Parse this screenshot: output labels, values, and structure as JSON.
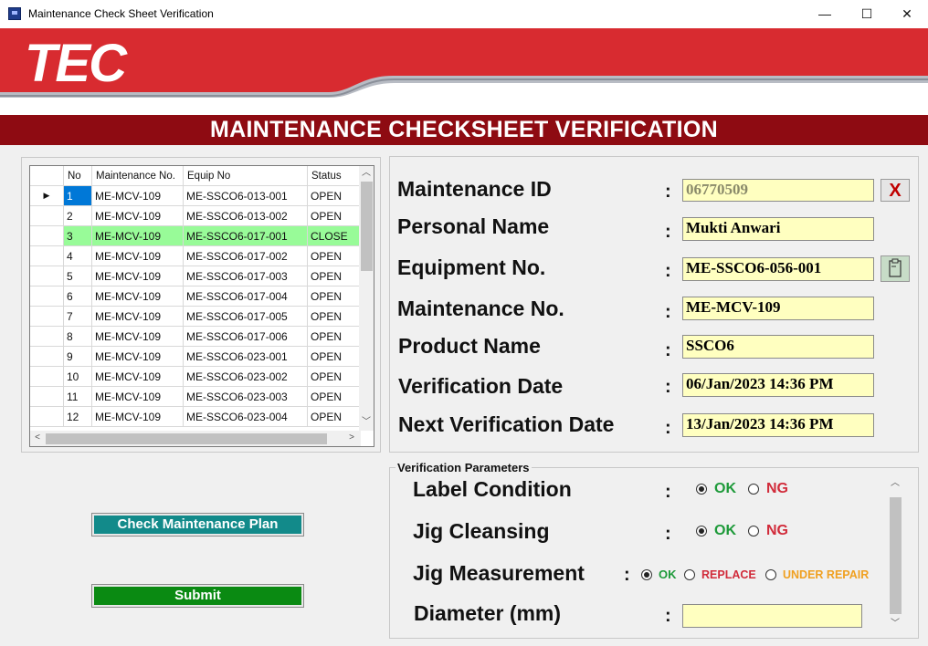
{
  "window": {
    "title": "Maintenance Check Sheet Verification",
    "minimize": "—",
    "maximize": "☐",
    "close": "✕"
  },
  "banner": {
    "logo": "TEC"
  },
  "header": {
    "title": "MAINTENANCE CHECKSHEET VERIFICATION"
  },
  "grid": {
    "columns": [
      "No",
      "Maintenance No.",
      "Equip No",
      "Status"
    ],
    "rows": [
      [
        "1",
        "ME-MCV-109",
        "ME-SSCO6-013-001",
        "OPEN"
      ],
      [
        "2",
        "ME-MCV-109",
        "ME-SSCO6-013-002",
        "OPEN"
      ],
      [
        "3",
        "ME-MCV-109",
        "ME-SSCO6-017-001",
        "CLOSE"
      ],
      [
        "4",
        "ME-MCV-109",
        "ME-SSCO6-017-002",
        "OPEN"
      ],
      [
        "5",
        "ME-MCV-109",
        "ME-SSCO6-017-003",
        "OPEN"
      ],
      [
        "6",
        "ME-MCV-109",
        "ME-SSCO6-017-004",
        "OPEN"
      ],
      [
        "7",
        "ME-MCV-109",
        "ME-SSCO6-017-005",
        "OPEN"
      ],
      [
        "8",
        "ME-MCV-109",
        "ME-SSCO6-017-006",
        "OPEN"
      ],
      [
        "9",
        "ME-MCV-109",
        "ME-SSCO6-023-001",
        "OPEN"
      ],
      [
        "10",
        "ME-MCV-109",
        "ME-SSCO6-023-002",
        "OPEN"
      ],
      [
        "11",
        "ME-MCV-109",
        "ME-SSCO6-023-003",
        "OPEN"
      ],
      [
        "12",
        "ME-MCV-109",
        "ME-SSCO6-023-004",
        "OPEN"
      ]
    ],
    "selected_row": 0,
    "close_row": 2
  },
  "buttons": {
    "check_plan": "Check Maintenance Plan",
    "submit": "Submit",
    "clear": "X"
  },
  "form": {
    "maintenance_id": {
      "label": "Maintenance ID",
      "value": "06770509"
    },
    "personal_name": {
      "label": "Personal Name",
      "value": "Mukti Anwari"
    },
    "equipment_no": {
      "label": "Equipment No.",
      "value": "ME-SSCO6-056-001"
    },
    "maintenance_no": {
      "label": "Maintenance No.",
      "value": "ME-MCV-109"
    },
    "product_name": {
      "label": "Product Name",
      "value": "SSCO6"
    },
    "verification_date": {
      "label": "Verification Date",
      "value": "06/Jan/2023 14:36 PM"
    },
    "next_verification_date": {
      "label": "Next Verification Date",
      "value": "13/Jan/2023 14:36 PM"
    },
    "colon": ":"
  },
  "params": {
    "title": "Verification Parameters",
    "label_condition": {
      "label": "Label Condition",
      "ok": "OK",
      "ng": "NG",
      "selected": "OK"
    },
    "jig_cleansing": {
      "label": "Jig Cleansing",
      "ok": "OK",
      "ng": "NG",
      "selected": "OK"
    },
    "jig_measurement": {
      "label": "Jig Measurement",
      "ok": "OK",
      "replace": "REPLACE",
      "under_repair": "UNDER REPAIR",
      "selected": "OK"
    },
    "diameter": {
      "label": "Diameter (mm)",
      "value": ""
    }
  }
}
